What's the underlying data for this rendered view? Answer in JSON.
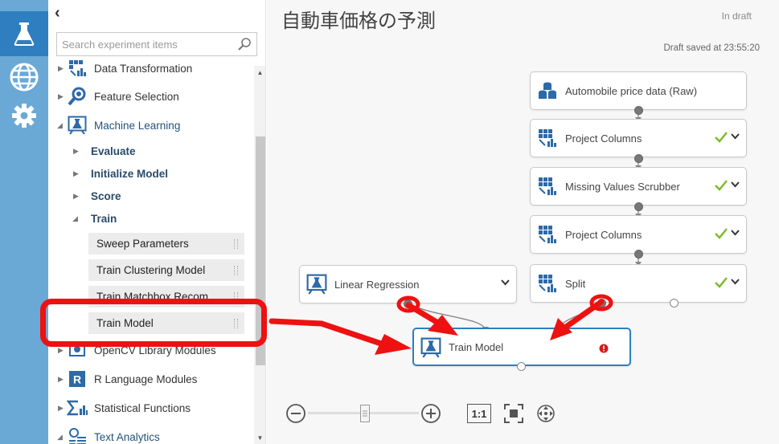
{
  "window": {
    "experiment_title": "自動車価格の予測",
    "status": "In draft",
    "saved_text": "Draft saved at 23:55:20"
  },
  "rail": {
    "items": [
      {
        "icon": "flask-icon"
      },
      {
        "icon": "globe-icon"
      },
      {
        "icon": "gear-icon"
      }
    ]
  },
  "palette": {
    "collapse_glyph": "‹",
    "search_placeholder": "Search experiment items",
    "categories": {
      "data_transformation": "Data Transformation",
      "feature_selection": "Feature Selection",
      "machine_learning": "Machine Learning",
      "evaluate": "Evaluate",
      "initialize_model": "Initialize Model",
      "score": "Score",
      "train": "Train",
      "opencv": "OpenCV Library Modules",
      "r_language": "R Language Modules",
      "statistical": "Statistical Functions",
      "text_analytics": "Text Analytics"
    },
    "train_modules": [
      "Sweep Parameters",
      "Train Clustering Model",
      "Train Matchbox Recom...",
      "Train Model"
    ]
  },
  "canvas": {
    "nodes": {
      "automobile": "Automobile price data (Raw)",
      "project1": "Project Columns",
      "missing": "Missing Values Scrubber",
      "project2": "Project Columns",
      "split": "Split",
      "linear": "Linear Regression",
      "train": "Train Model"
    },
    "zoom_fit_label": "1:1"
  },
  "colors": {
    "rail": "#6aa9d6",
    "rail_active": "#2f7ec0",
    "selected_border": "#2e7ec1",
    "annotation_red": "#ee1111",
    "check_green": "#7cbb2e"
  }
}
